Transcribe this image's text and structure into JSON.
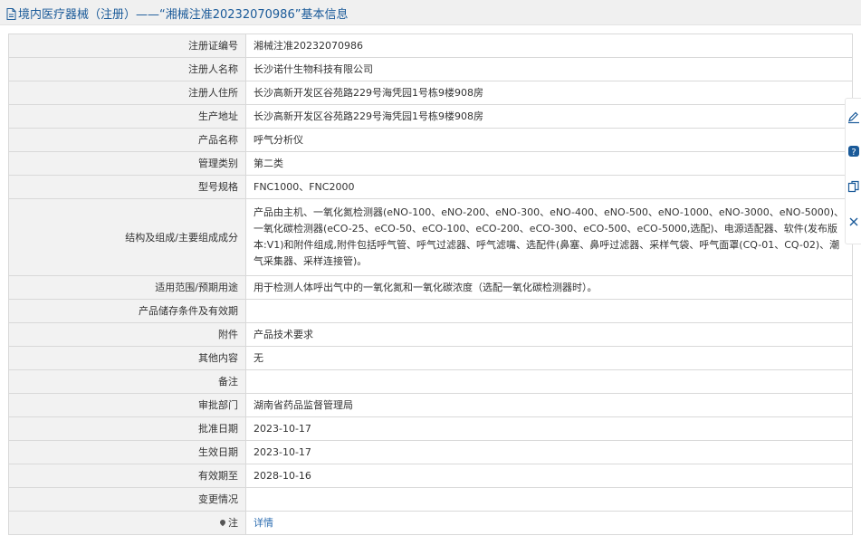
{
  "header": {
    "title": "境内医疗器械（注册）——“湘械注准20232070986”基本信息"
  },
  "rows": [
    {
      "label": "注册证编号",
      "value": "湘械注准20232070986"
    },
    {
      "label": "注册人名称",
      "value": "长沙诺什生物科技有限公司"
    },
    {
      "label": "注册人住所",
      "value": "长沙高新开发区谷苑路229号海凭园1号栋9楼908房"
    },
    {
      "label": "生产地址",
      "value": "长沙高新开发区谷苑路229号海凭园1号栋9楼908房"
    },
    {
      "label": "产品名称",
      "value": "呼气分析仪"
    },
    {
      "label": "管理类别",
      "value": "第二类"
    },
    {
      "label": "型号规格",
      "value": "FNC1000、FNC2000"
    },
    {
      "label": "结构及组成/主要组成成分",
      "value": "产品由主机、一氧化氮检测器(eNO-100、eNO-200、eNO-300、eNO-400、eNO-500、eNO-1000、eNO-3000、eNO-5000)、一氧化碳检测器(eCO-25、eCO-50、eCO-100、eCO-200、eCO-300、eCO-500、eCO-5000,选配)、电源适配器、软件(发布版本:V1)和附件组成,附件包括呼气管、呼气过滤器、呼气滤嘴、选配件(鼻塞、鼻呼过滤器、采样气袋、呼气面罩(CQ-01、CQ-02)、潮气采集器、采样连接管)。"
    },
    {
      "label": "适用范围/预期用途",
      "value": "用于检测人体呼出气中的一氧化氮和一氧化碳浓度（选配一氧化碳检测器时）。"
    },
    {
      "label": "产品储存条件及有效期",
      "value": ""
    },
    {
      "label": "附件",
      "value": "产品技术要求"
    },
    {
      "label": "其他内容",
      "value": "无"
    },
    {
      "label": "备注",
      "value": ""
    },
    {
      "label": "审批部门",
      "value": "湖南省药品监督管理局"
    },
    {
      "label": "批准日期",
      "value": "2023-10-17"
    },
    {
      "label": "生效日期",
      "value": "2023-10-17"
    },
    {
      "label": "有效期至",
      "value": "2028-10-16"
    },
    {
      "label": "变更情况",
      "value": ""
    }
  ],
  "note_row": {
    "label": "注",
    "link_text": "详情"
  },
  "side_tools": [
    "edit-icon",
    "help-icon",
    "copy-icon",
    "close-icon"
  ],
  "colors": {
    "title": "#1a5a99",
    "link": "#2b6cb0",
    "label_bg": "#f2f2f2",
    "border": "#d9d9d9"
  }
}
